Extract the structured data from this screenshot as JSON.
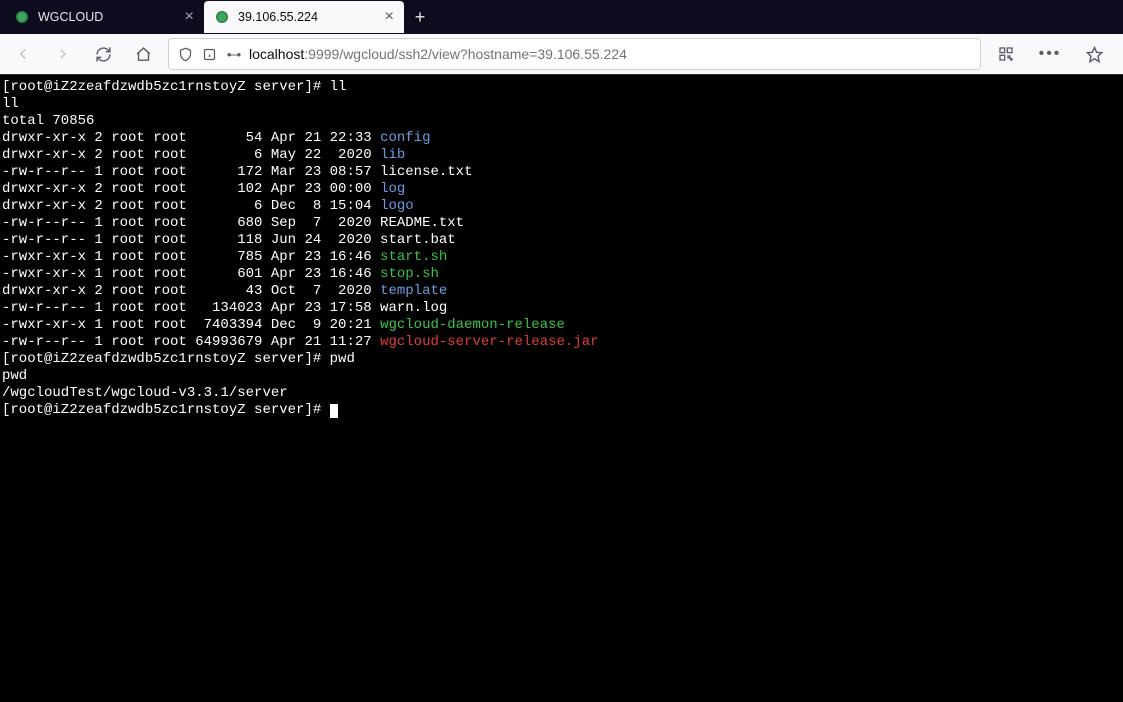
{
  "tabs": [
    {
      "label": "WGCLOUD",
      "active": false
    },
    {
      "label": "39.106.55.224",
      "active": true
    }
  ],
  "url": {
    "host": "localhost",
    "rest": ":9999/wgcloud/ssh2/view?hostname=39.106.55.224"
  },
  "terminal": {
    "prompt": "[root@iZ2zeafdzwdb5zc1rnstoyZ server]#",
    "cmd1": "ll",
    "echo1": "ll",
    "total": "total 70856",
    "rows": [
      {
        "perm": "drwxr-xr-x",
        "ln": "2",
        "own": "root",
        "grp": "root",
        "size": "      54",
        "date": "Apr 21 22:33",
        "name": "config",
        "cls": "c-blue"
      },
      {
        "perm": "drwxr-xr-x",
        "ln": "2",
        "own": "root",
        "grp": "root",
        "size": "       6",
        "date": "May 22  2020",
        "name": "lib",
        "cls": "c-blue"
      },
      {
        "perm": "-rw-r--r--",
        "ln": "1",
        "own": "root",
        "grp": "root",
        "size": "     172",
        "date": "Mar 23 08:57",
        "name": "license.txt",
        "cls": ""
      },
      {
        "perm": "drwxr-xr-x",
        "ln": "2",
        "own": "root",
        "grp": "root",
        "size": "     102",
        "date": "Apr 23 00:00",
        "name": "log",
        "cls": "c-blue"
      },
      {
        "perm": "drwxr-xr-x",
        "ln": "2",
        "own": "root",
        "grp": "root",
        "size": "       6",
        "date": "Dec  8 15:04",
        "name": "logo",
        "cls": "c-blue"
      },
      {
        "perm": "-rw-r--r--",
        "ln": "1",
        "own": "root",
        "grp": "root",
        "size": "     680",
        "date": "Sep  7  2020",
        "name": "README.txt",
        "cls": ""
      },
      {
        "perm": "-rw-r--r--",
        "ln": "1",
        "own": "root",
        "grp": "root",
        "size": "     118",
        "date": "Jun 24  2020",
        "name": "start.bat",
        "cls": ""
      },
      {
        "perm": "-rwxr-xr-x",
        "ln": "1",
        "own": "root",
        "grp": "root",
        "size": "     785",
        "date": "Apr 23 16:46",
        "name": "start.sh",
        "cls": "c-green"
      },
      {
        "perm": "-rwxr-xr-x",
        "ln": "1",
        "own": "root",
        "grp": "root",
        "size": "     601",
        "date": "Apr 23 16:46",
        "name": "stop.sh",
        "cls": "c-green"
      },
      {
        "perm": "drwxr-xr-x",
        "ln": "2",
        "own": "root",
        "grp": "root",
        "size": "      43",
        "date": "Oct  7  2020",
        "name": "template",
        "cls": "c-blue"
      },
      {
        "perm": "-rw-r--r--",
        "ln": "1",
        "own": "root",
        "grp": "root",
        "size": "  134023",
        "date": "Apr 23 17:58",
        "name": "warn.log",
        "cls": ""
      },
      {
        "perm": "-rwxr-xr-x",
        "ln": "1",
        "own": "root",
        "grp": "root",
        "size": " 7403394",
        "date": "Dec  9 20:21",
        "name": "wgcloud-daemon-release",
        "cls": "c-green"
      },
      {
        "perm": "-rw-r--r--",
        "ln": "1",
        "own": "root",
        "grp": "root",
        "size": "64993679",
        "date": "Apr 21 11:27",
        "name": "wgcloud-server-release.jar",
        "cls": "c-red"
      }
    ],
    "cmd2": "pwd",
    "echo2": "pwd",
    "pwd_out": "/wgcloudTest/wgcloud-v3.3.1/server"
  }
}
